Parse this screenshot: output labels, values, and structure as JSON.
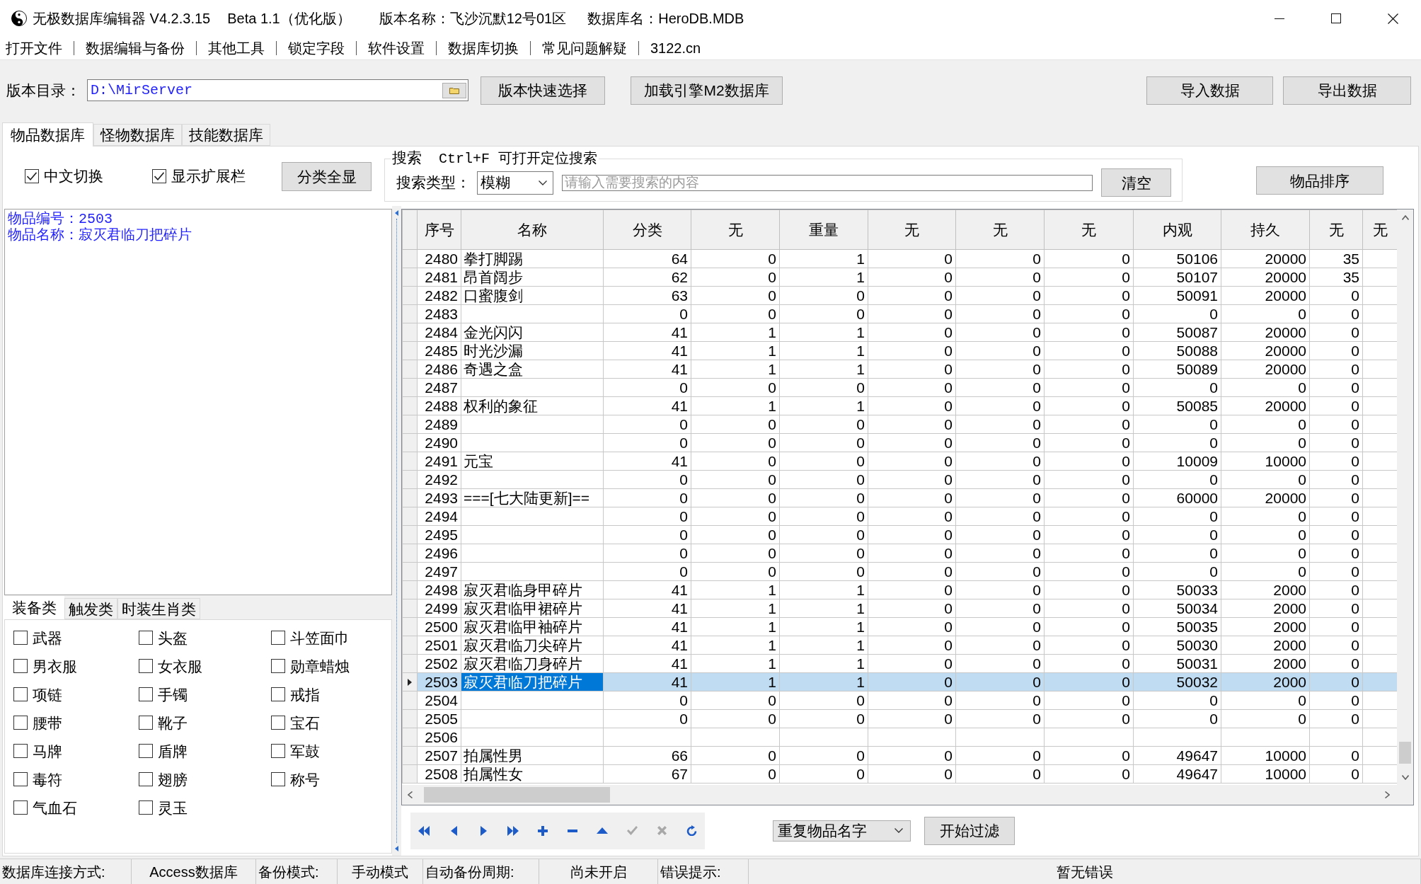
{
  "window": {
    "title": "无极数据库编辑器 V4.2.3.15",
    "edition": "Beta 1.1（优化版）",
    "version_name": "版本名称：飞沙沉默12号01区",
    "database_name": "数据库名：HeroDB.MDB"
  },
  "menu": [
    "打开文件",
    "数据编辑与备份",
    "其他工具",
    "锁定字段",
    "软件设置",
    "数据库切换",
    "常见问题解疑",
    "3122.cn"
  ],
  "toolbar": {
    "directory_label": "版本目录：",
    "directory": "D:\\MirServer",
    "buttons": [
      "版本快速选择",
      "加载引擎M2数据库"
    ],
    "right_buttons": [
      "导入数据",
      "导出数据"
    ]
  },
  "tabs": [
    {
      "label": "物品数据库",
      "selected": true
    },
    {
      "label": "怪物数据库",
      "selected": false
    },
    {
      "label": "技能数据库",
      "selected": false
    }
  ],
  "filters": {
    "checkboxes": [
      {
        "label": "中文切换",
        "checked": true
      },
      {
        "label": "显示扩展栏",
        "checked": true
      }
    ],
    "show_all_button": "分类全显"
  },
  "search": {
    "title": "搜索",
    "hint": "Ctrl+F 可打开定位搜索",
    "type_label": "搜索类型：",
    "type": "模糊",
    "placeholder": "请输入需要搜索的内容",
    "clear_button": "清空"
  },
  "sort_button": "物品排序",
  "detail": [
    "物品编号：2503",
    "物品名称：寂灭君临刀把碎片"
  ],
  "category_tabs": [
    {
      "label": "装备类",
      "selected": true
    },
    {
      "label": "触发类",
      "selected": false
    },
    {
      "label": "时装生肖类",
      "selected": false
    }
  ],
  "categories": [
    {
      "label": "武器",
      "checked": false
    },
    {
      "label": "头盔",
      "checked": false
    },
    {
      "label": "斗笠面巾",
      "checked": false
    },
    {
      "label": "男衣服",
      "checked": false
    },
    {
      "label": "女衣服",
      "checked": false
    },
    {
      "label": "勋章蜡烛",
      "checked": false
    },
    {
      "label": "项链",
      "checked": false
    },
    {
      "label": "手镯",
      "checked": false
    },
    {
      "label": "戒指",
      "checked": false
    },
    {
      "label": "腰带",
      "checked": false
    },
    {
      "label": "靴子",
      "checked": false
    },
    {
      "label": "宝石",
      "checked": false
    },
    {
      "label": "马牌",
      "checked": false
    },
    {
      "label": "盾牌",
      "checked": false
    },
    {
      "label": "军鼓",
      "checked": false
    },
    {
      "label": "毒符",
      "checked": false
    },
    {
      "label": "翅膀",
      "checked": false
    },
    {
      "label": "称号",
      "checked": false
    },
    {
      "label": "气血石",
      "checked": false
    },
    {
      "label": "灵玉",
      "checked": false
    }
  ],
  "table": {
    "columns": [
      "序号",
      "名称",
      "分类",
      "无",
      "重量",
      "无",
      "无",
      "无",
      "内观",
      "持久",
      "无",
      "无"
    ],
    "rows": [
      {
        "id": "2480",
        "name": "拳打脚踢",
        "values": [
          "64",
          "0",
          "1",
          "0",
          "0",
          "0",
          "50106",
          "20000",
          "35"
        ],
        "selected": false
      },
      {
        "id": "2481",
        "name": "昂首阔步",
        "values": [
          "62",
          "0",
          "1",
          "0",
          "0",
          "0",
          "50107",
          "20000",
          "35"
        ],
        "selected": false
      },
      {
        "id": "2482",
        "name": "口蜜腹剑",
        "values": [
          "63",
          "0",
          "0",
          "0",
          "0",
          "0",
          "50091",
          "20000",
          "0"
        ],
        "selected": false
      },
      {
        "id": "2483",
        "values": [
          "0",
          "0",
          "0",
          "0",
          "0",
          "0",
          "0",
          "0",
          "0"
        ],
        "selected": false
      },
      {
        "id": "2484",
        "name": "金光闪闪",
        "values": [
          "41",
          "1",
          "1",
          "0",
          "0",
          "0",
          "50087",
          "20000",
          "0"
        ],
        "selected": false
      },
      {
        "id": "2485",
        "name": "时光沙漏",
        "values": [
          "41",
          "1",
          "1",
          "0",
          "0",
          "0",
          "50088",
          "20000",
          "0"
        ],
        "selected": false
      },
      {
        "id": "2486",
        "name": "奇遇之盒",
        "values": [
          "41",
          "1",
          "1",
          "0",
          "0",
          "0",
          "50089",
          "20000",
          "0"
        ],
        "selected": false
      },
      {
        "id": "2487",
        "values": [
          "0",
          "0",
          "0",
          "0",
          "0",
          "0",
          "0",
          "0",
          "0"
        ],
        "selected": false
      },
      {
        "id": "2488",
        "name": "权利的象征",
        "values": [
          "41",
          "1",
          "1",
          "0",
          "0",
          "0",
          "50085",
          "20000",
          "0"
        ],
        "selected": false
      },
      {
        "id": "2489",
        "values": [
          "0",
          "0",
          "0",
          "0",
          "0",
          "0",
          "0",
          "0",
          "0"
        ],
        "selected": false
      },
      {
        "id": "2490",
        "values": [
          "0",
          "0",
          "0",
          "0",
          "0",
          "0",
          "0",
          "0",
          "0"
        ],
        "selected": false
      },
      {
        "id": "2491",
        "name": "元宝",
        "values": [
          "41",
          "0",
          "0",
          "0",
          "0",
          "0",
          "10009",
          "10000",
          "0"
        ],
        "selected": false
      },
      {
        "id": "2492",
        "values": [
          "0",
          "0",
          "0",
          "0",
          "0",
          "0",
          "0",
          "0",
          "0"
        ],
        "selected": false
      },
      {
        "id": "2493",
        "name": "===[七大陆更新]==",
        "values": [
          "0",
          "0",
          "0",
          "0",
          "0",
          "0",
          "60000",
          "20000",
          "0"
        ],
        "selected": false
      },
      {
        "id": "2494",
        "values": [
          "0",
          "0",
          "0",
          "0",
          "0",
          "0",
          "0",
          "0",
          "0"
        ],
        "selected": false
      },
      {
        "id": "2495",
        "values": [
          "0",
          "0",
          "0",
          "0",
          "0",
          "0",
          "0",
          "0",
          "0"
        ],
        "selected": false
      },
      {
        "id": "2496",
        "values": [
          "0",
          "0",
          "0",
          "0",
          "0",
          "0",
          "0",
          "0",
          "0"
        ],
        "selected": false
      },
      {
        "id": "2497",
        "values": [
          "0",
          "0",
          "0",
          "0",
          "0",
          "0",
          "0",
          "0",
          "0"
        ],
        "selected": false
      },
      {
        "id": "2498",
        "name": "寂灭君临身甲碎片",
        "values": [
          "41",
          "1",
          "1",
          "0",
          "0",
          "0",
          "50033",
          "2000",
          "0"
        ],
        "selected": false
      },
      {
        "id": "2499",
        "name": "寂灭君临甲裙碎片",
        "values": [
          "41",
          "1",
          "1",
          "0",
          "0",
          "0",
          "50034",
          "2000",
          "0"
        ],
        "selected": false
      },
      {
        "id": "2500",
        "name": "寂灭君临甲袖碎片",
        "values": [
          "41",
          "1",
          "1",
          "0",
          "0",
          "0",
          "50035",
          "2000",
          "0"
        ],
        "selected": false
      },
      {
        "id": "2501",
        "name": "寂灭君临刀尖碎片",
        "values": [
          "41",
          "1",
          "1",
          "0",
          "0",
          "0",
          "50030",
          "2000",
          "0"
        ],
        "selected": false
      },
      {
        "id": "2502",
        "name": "寂灭君临刀身碎片",
        "values": [
          "41",
          "1",
          "1",
          "0",
          "0",
          "0",
          "50031",
          "2000",
          "0"
        ],
        "selected": false
      },
      {
        "id": "2503",
        "name": "寂灭君临刀把碎片",
        "values": [
          "41",
          "1",
          "1",
          "0",
          "0",
          "0",
          "50032",
          "2000",
          "0"
        ],
        "selected": true
      },
      {
        "id": "2504",
        "values": [
          "0",
          "0",
          "0",
          "0",
          "0",
          "0",
          "0",
          "0",
          "0"
        ],
        "selected": false
      },
      {
        "id": "2505",
        "values": [
          "0",
          "0",
          "0",
          "0",
          "0",
          "0",
          "0",
          "0",
          "0"
        ],
        "selected": false
      },
      {
        "id": "2506",
        "selected": false
      },
      {
        "id": "2507",
        "name": "拍属性男",
        "values": [
          "66",
          "0",
          "0",
          "0",
          "0",
          "0",
          "49647",
          "10000",
          "0"
        ],
        "selected": false
      },
      {
        "id": "2508",
        "name": "拍属性女",
        "values": [
          "67",
          "0",
          "0",
          "0",
          "0",
          "0",
          "49647",
          "10000",
          "0"
        ],
        "selected": false
      }
    ]
  },
  "navigator": [
    {
      "disabled": false
    },
    {
      "disabled": false
    },
    {
      "disabled": false
    },
    {
      "disabled": false
    },
    {
      "disabled": false
    },
    {
      "disabled": false
    },
    {
      "disabled": false
    },
    {
      "disabled": true
    },
    {
      "disabled": true
    },
    {
      "disabled": false
    }
  ],
  "filter": {
    "mode": "重复物品名字",
    "button": "开始过滤"
  },
  "status_bar": [
    {
      "label": "数据库连接方式:",
      "value": "Access数据库"
    },
    {
      "label": "备份模式:",
      "value": "手动模式"
    },
    {
      "label": "自动备份周期:",
      "value": "尚未开启"
    },
    {
      "label": "错误提示:",
      "value": "暂无错误"
    }
  ]
}
